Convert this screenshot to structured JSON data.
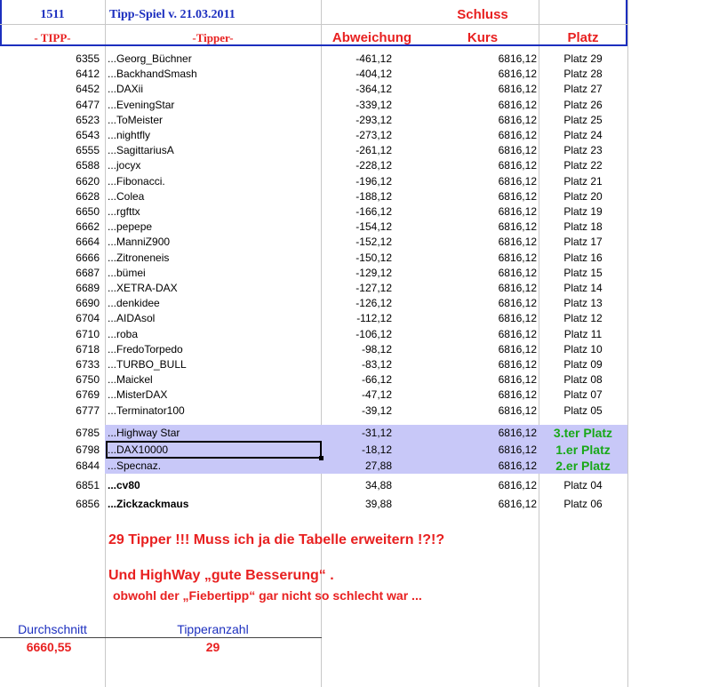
{
  "header": {
    "row1": {
      "id": "1511",
      "title": "Tipp-Spiel v. 21.03.2011",
      "schluss": "Schluss"
    },
    "row2": {
      "tipp": "- TIPP-",
      "tipper": "-Tipper-",
      "abweichung": "Abweichung",
      "kurs": "Kurs",
      "platz": "Platz"
    }
  },
  "rows": [
    {
      "tipp": "6355",
      "name": "...Georg_Büchner",
      "abw": "-461,12",
      "kurs": "6816,12",
      "platz": "Platz 29"
    },
    {
      "tipp": "6412",
      "name": "...BackhandSmash",
      "abw": "-404,12",
      "kurs": "6816,12",
      "platz": "Platz 28"
    },
    {
      "tipp": "6452",
      "name": "...DAXii",
      "abw": "-364,12",
      "kurs": "6816,12",
      "platz": "Platz 27"
    },
    {
      "tipp": "6477",
      "name": "...EveningStar",
      "abw": "-339,12",
      "kurs": "6816,12",
      "platz": "Platz 26"
    },
    {
      "tipp": "6523",
      "name": "...ToMeister",
      "abw": "-293,12",
      "kurs": "6816,12",
      "platz": "Platz 25"
    },
    {
      "tipp": "6543",
      "name": "...nightfly",
      "abw": "-273,12",
      "kurs": "6816,12",
      "platz": "Platz 24"
    },
    {
      "tipp": "6555",
      "name": "...SagittariusA",
      "abw": "-261,12",
      "kurs": "6816,12",
      "platz": "Platz 23"
    },
    {
      "tipp": "6588",
      "name": "...jocyx",
      "abw": "-228,12",
      "kurs": "6816,12",
      "platz": "Platz 22"
    },
    {
      "tipp": "6620",
      "name": "...Fibonacci.",
      "abw": "-196,12",
      "kurs": "6816,12",
      "platz": "Platz 21"
    },
    {
      "tipp": "6628",
      "name": "...Colea",
      "abw": "-188,12",
      "kurs": "6816,12",
      "platz": "Platz 20"
    },
    {
      "tipp": "6650",
      "name": "...rgfttx",
      "abw": "-166,12",
      "kurs": "6816,12",
      "platz": "Platz 19"
    },
    {
      "tipp": "6662",
      "name": "...pepepe",
      "abw": "-154,12",
      "kurs": "6816,12",
      "platz": "Platz 18"
    },
    {
      "tipp": "6664",
      "name": "...ManniZ900",
      "abw": "-152,12",
      "kurs": "6816,12",
      "platz": "Platz 17"
    },
    {
      "tipp": "6666",
      "name": "...Zitroneneis",
      "abw": "-150,12",
      "kurs": "6816,12",
      "platz": "Platz 16"
    },
    {
      "tipp": "6687",
      "name": "...bümei",
      "abw": "-129,12",
      "kurs": "6816,12",
      "platz": "Platz 15"
    },
    {
      "tipp": "6689",
      "name": "...XETRA-DAX",
      "abw": "-127,12",
      "kurs": "6816,12",
      "platz": "Platz 14"
    },
    {
      "tipp": "6690",
      "name": "...denkidee",
      "abw": "-126,12",
      "kurs": "6816,12",
      "platz": "Platz 13"
    },
    {
      "tipp": "6704",
      "name": "...AIDAsol",
      "abw": "-112,12",
      "kurs": "6816,12",
      "platz": "Platz 12"
    },
    {
      "tipp": "6710",
      "name": "...roba",
      "abw": "-106,12",
      "kurs": "6816,12",
      "platz": "Platz 11"
    },
    {
      "tipp": "6718",
      "name": "...FredoTorpedo",
      "abw": "-98,12",
      "kurs": "6816,12",
      "platz": "Platz 10"
    },
    {
      "tipp": "6733",
      "name": "...TURBO_BULL",
      "abw": "-83,12",
      "kurs": "6816,12",
      "platz": "Platz 09"
    },
    {
      "tipp": "6750",
      "name": "...Maickel",
      "abw": "-66,12",
      "kurs": "6816,12",
      "platz": "Platz 08"
    },
    {
      "tipp": "6769",
      "name": "...MisterDAX",
      "abw": "-47,12",
      "kurs": "6816,12",
      "platz": "Platz 07"
    },
    {
      "tipp": "6777",
      "name": "...Terminator100",
      "abw": "-39,12",
      "kurs": "6816,12",
      "platz": "Platz 05"
    },
    {
      "tipp": "6785",
      "name": "...Highway Star",
      "abw": "-31,12",
      "kurs": "6816,12",
      "platz": "3.ter Platz"
    },
    {
      "tipp": "6798",
      "name": "...DAX10000",
      "abw": "-18,12",
      "kurs": "6816,12",
      "platz": "1.er Platz"
    },
    {
      "tipp": "6844",
      "name": "...Specnaz.",
      "abw": "27,88",
      "kurs": "6816,12",
      "platz": "2.er Platz"
    },
    {
      "tipp": "6851",
      "name": "...cv80",
      "abw": "34,88",
      "kurs": "6816,12",
      "platz": "Platz 04"
    },
    {
      "tipp": "6856",
      "name": "...Zickzackmaus",
      "abw": "39,88",
      "kurs": "6816,12",
      "platz": "Platz 06"
    }
  ],
  "notes": {
    "line1": "29 Tipper !!! Muss ich ja die Tabelle erweitern !?!?",
    "line2": "Und HighWay „gute Besserung“ .",
    "line3": "obwohl der „Fiebertipp“ gar nicht so schlecht war ..."
  },
  "footer": {
    "avg_label": "Durchschnitt",
    "avg_value": "6660,55",
    "count_label": "Tipperanzahl",
    "count_value": "29"
  },
  "colors": {
    "header_blue": "#1c2fbf",
    "accent_red": "#e82020",
    "highlight": "#c8c8f8",
    "winner_green": "#18a818"
  }
}
